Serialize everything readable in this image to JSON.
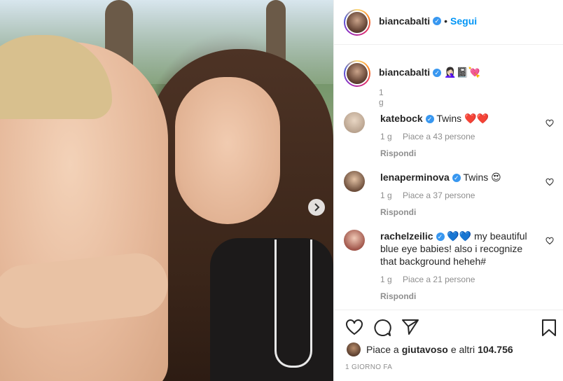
{
  "header": {
    "username": "biancabalti",
    "separator": "•",
    "follow_label": "Segui"
  },
  "caption": {
    "username": "biancabalti",
    "text": "🤦🏻‍♀️📓💘",
    "time": "1 g"
  },
  "comments": [
    {
      "username": "katebock",
      "text": "Twins ❤️❤️",
      "time": "1 g",
      "likes": "Piace a 43 persone",
      "reply": "Rispondi"
    },
    {
      "username": "lenaperminova",
      "text": "Twins 😍",
      "time": "1 g",
      "likes": "Piace a 37 persone",
      "reply": "Rispondi"
    },
    {
      "username": "rachelzeilic",
      "text": "💙💙 my beautiful blue eye babies! also i recognize that background heheh#",
      "time": "1 g",
      "likes": "Piace a 21 persone",
      "reply": "Rispondi"
    }
  ],
  "likes_bar": {
    "prefix": "Piace a",
    "user": "giutavoso",
    "suffix": "e altri",
    "count": "104.756"
  },
  "post_time": "1 GIORNO FA",
  "icons": [
    "heart-icon",
    "comment-icon",
    "share-icon",
    "bookmark-icon",
    "verified-icon",
    "chevron-right-icon"
  ]
}
